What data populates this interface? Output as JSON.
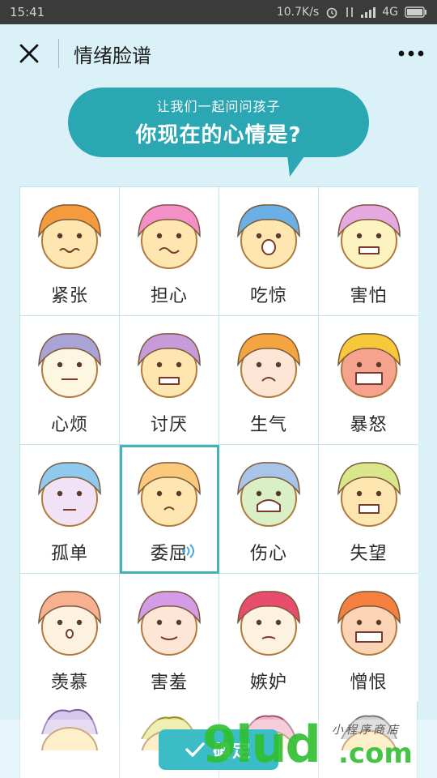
{
  "status_bar": {
    "time": "15:41",
    "speed": "10.7K/s",
    "network": "4G"
  },
  "nav": {
    "title": "情绪脸谱"
  },
  "bubble": {
    "subtitle": "让我们一起问问孩子",
    "question": "你现在的心情是?"
  },
  "emotions": [
    {
      "label": "紧张",
      "hair": "#f59a3d",
      "skin": "#fde6b0",
      "mood": "nervous"
    },
    {
      "label": "担心",
      "hair": "#f48fc7",
      "skin": "#fde6b0",
      "mood": "worried"
    },
    {
      "label": "吃惊",
      "hair": "#6ab0e6",
      "skin": "#fde6b0",
      "mood": "surprised"
    },
    {
      "label": "害怕",
      "hair": "#e5a8e0",
      "skin": "#fdf3c0",
      "mood": "scared"
    },
    {
      "label": "心烦",
      "hair": "#a9a3d6",
      "skin": "#fdf6e0",
      "mood": "annoyed"
    },
    {
      "label": "讨厌",
      "hair": "#c79ad9",
      "skin": "#fde6b0",
      "mood": "disgusted"
    },
    {
      "label": "生气",
      "hair": "#f5a540",
      "skin": "#fde6d6",
      "mood": "angry"
    },
    {
      "label": "暴怒",
      "hair": "#f6c93b",
      "skin": "#f7a28f",
      "mood": "furious"
    },
    {
      "label": "孤单",
      "hair": "#8fc9ee",
      "skin": "#f1e3f5",
      "mood": "lonely"
    },
    {
      "label": "委屈",
      "hair": "#fbc97c",
      "skin": "#fde6b0",
      "mood": "aggrieved"
    },
    {
      "label": "伤心",
      "hair": "#a8c4e8",
      "skin": "#d9efc6",
      "mood": "sad"
    },
    {
      "label": "失望",
      "hair": "#d9e78a",
      "skin": "#fde6b0",
      "mood": "disappointed"
    },
    {
      "label": "羡慕",
      "hair": "#f7b191",
      "skin": "#fdf1e0",
      "mood": "envious"
    },
    {
      "label": "害羞",
      "hair": "#d49be6",
      "skin": "#fde6d6",
      "mood": "shy"
    },
    {
      "label": "嫉妒",
      "hair": "#e84d6d",
      "skin": "#fdf1e0",
      "mood": "jealous"
    },
    {
      "label": "憎恨",
      "hair": "#f5803f",
      "skin": "#fbd3b5",
      "mood": "hateful"
    }
  ],
  "selected_emotion": "委屈",
  "footer": {
    "confirm_label": "确定"
  },
  "watermark": {
    "big": "9lud",
    "com": ".com",
    "small": "小程序商店"
  }
}
